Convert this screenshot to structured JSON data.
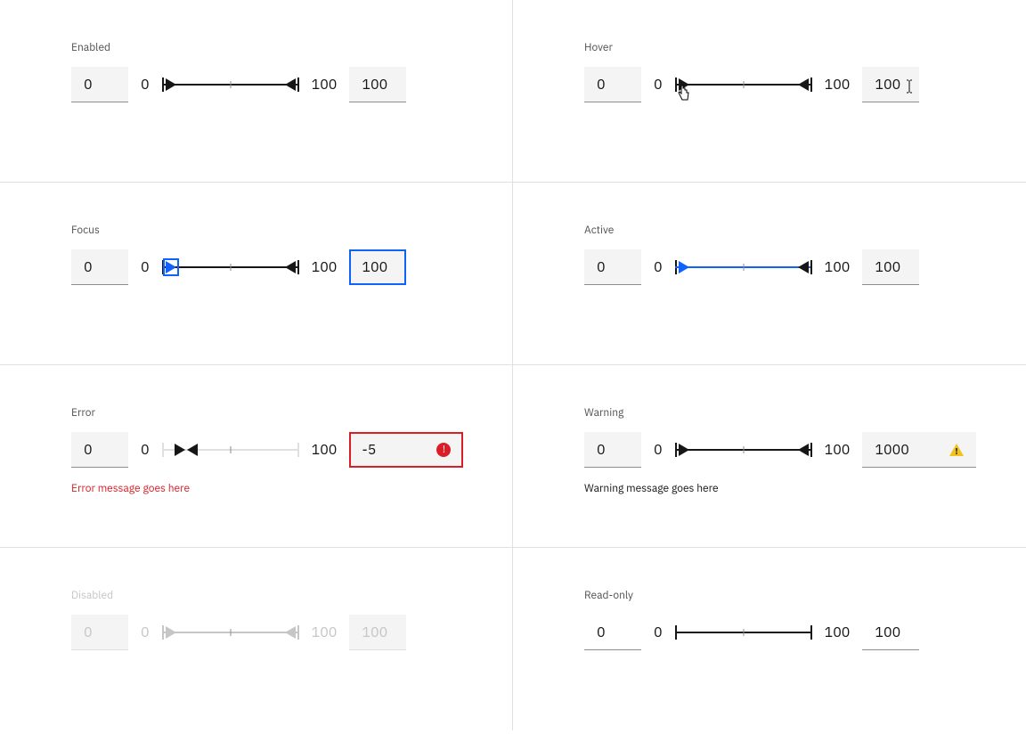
{
  "states": {
    "enabled": {
      "label": "Enabled",
      "min_val": "0",
      "max_val": "100",
      "min_scale": "0",
      "max_scale": "100"
    },
    "hover": {
      "label": "Hover",
      "min_val": "0",
      "max_val": "100",
      "min_scale": "0",
      "max_scale": "100"
    },
    "focus": {
      "label": "Focus",
      "min_val": "0",
      "max_val": "100",
      "min_scale": "0",
      "max_scale": "100"
    },
    "active": {
      "label": "Active",
      "min_val": "0",
      "max_val": "100",
      "min_scale": "0",
      "max_scale": "100"
    },
    "error": {
      "label": "Error",
      "min_val": "0",
      "max_val": "-5",
      "min_scale": "0",
      "max_scale": "100",
      "msg": "Error message goes here"
    },
    "warning": {
      "label": "Warning",
      "min_val": "0",
      "max_val": "1000",
      "min_scale": "0",
      "max_scale": "100",
      "msg": "Warning message goes here"
    },
    "disabled": {
      "label": "Disabled",
      "min_val": "0",
      "max_val": "100",
      "min_scale": "0",
      "max_scale": "100"
    },
    "readonly": {
      "label": "Read-only",
      "min_val": "0",
      "max_val": "100",
      "min_scale": "0",
      "max_scale": "100"
    }
  },
  "icons": {
    "error_glyph": "!",
    "warn_glyph": "!"
  }
}
